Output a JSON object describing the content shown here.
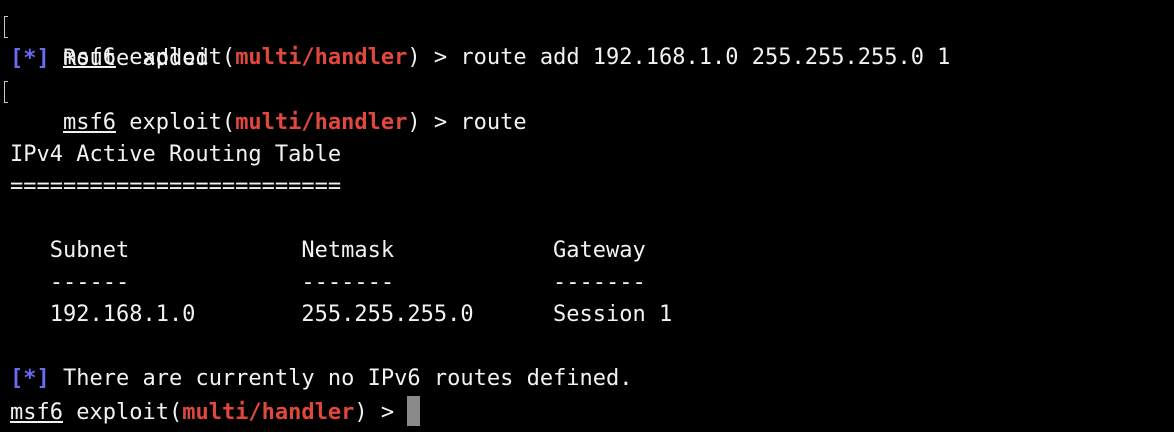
{
  "prompt": {
    "msf": "msf6",
    "exploit_prefix": " exploit(",
    "module": "multi/handler",
    "suffix": ") > "
  },
  "lines": {
    "cmd1": "route add 192.168.1.0 255.255.255.0 1",
    "info_tag": "[*]",
    "msg1": " Route added",
    "cmd2": "route",
    "table_title": "IPv4 Active Routing Table",
    "table_rule": "=========================",
    "header_row": "   Subnet             Netmask            Gateway",
    "dash_row": "   ------             -------            -------",
    "data_row": "   192.168.1.0        255.255.255.0      Session 1",
    "msg2": " There are currently no IPv6 routes defined."
  },
  "colors": {
    "background": "#000000",
    "foreground": "#f2f2f2",
    "module": "#e0483e",
    "info": "#6b6bf2",
    "cursor": "#8a8a8a"
  }
}
